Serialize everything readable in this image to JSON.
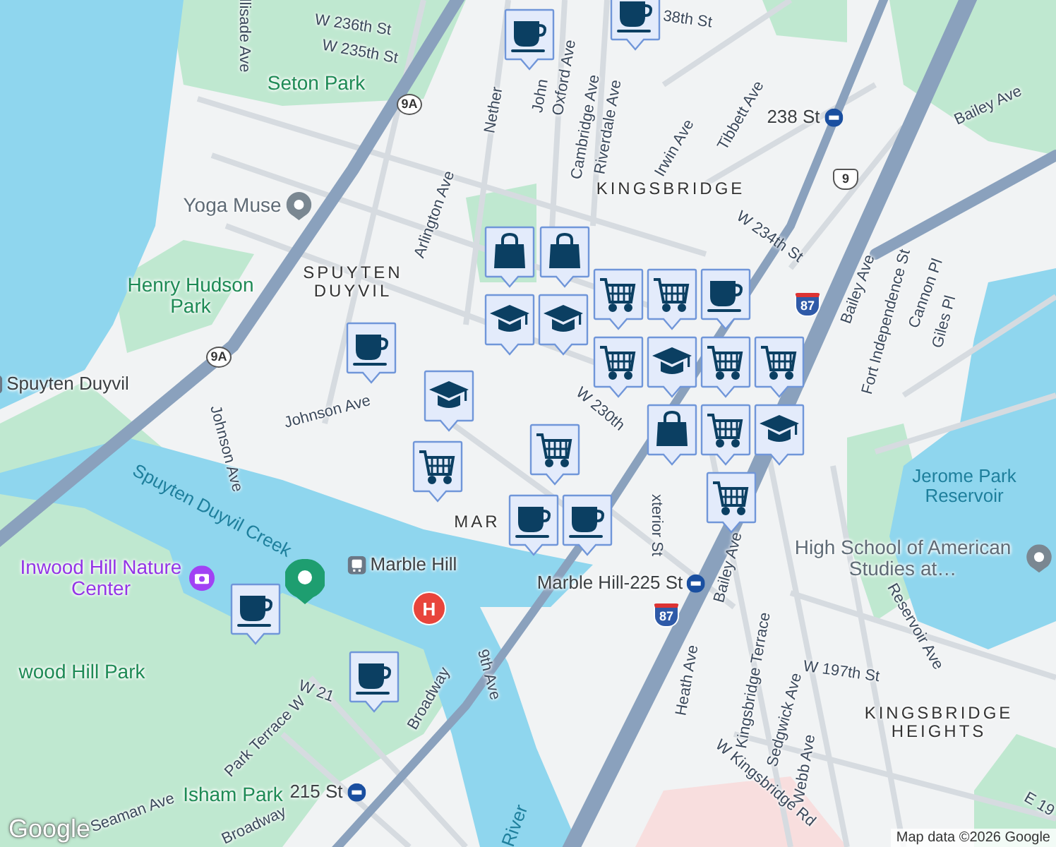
{
  "map": {
    "labels": [
      {
        "text": "W 236th St",
        "kind": "street"
      },
      {
        "text": "W 235th St",
        "kind": "street"
      },
      {
        "text": "llisade Ave",
        "kind": "street"
      },
      {
        "text": "Nether",
        "kind": "street"
      },
      {
        "text": "John",
        "kind": "street"
      },
      {
        "text": "38th St",
        "kind": "street"
      },
      {
        "text": "Oxford Ave",
        "kind": "street"
      },
      {
        "text": "Cambridge Ave",
        "kind": "street"
      },
      {
        "text": "Riverdale Ave",
        "kind": "street"
      },
      {
        "text": "Irwin Ave",
        "kind": "street"
      },
      {
        "text": "Tibbett Ave",
        "kind": "street"
      },
      {
        "text": "Arlington Ave",
        "kind": "street"
      },
      {
        "text": "W 234th St",
        "kind": "street"
      },
      {
        "text": "Bailey Ave",
        "kind": "street"
      },
      {
        "text": "Bailey Ave",
        "kind": "street"
      },
      {
        "text": "Fort Independence St",
        "kind": "street"
      },
      {
        "text": "Cannon Pl",
        "kind": "street"
      },
      {
        "text": "Giles Pl",
        "kind": "street"
      },
      {
        "text": "Johnson Ave",
        "kind": "street"
      },
      {
        "text": "Johnson Ave",
        "kind": "street"
      },
      {
        "text": "W 230th",
        "kind": "street"
      },
      {
        "text": "xterior St",
        "kind": "street"
      },
      {
        "text": "Bailey Ave",
        "kind": "street"
      },
      {
        "text": "Kingsbridge Terrace",
        "kind": "street"
      },
      {
        "text": "Heath Ave",
        "kind": "street"
      },
      {
        "text": "Sedgwick Ave",
        "kind": "street"
      },
      {
        "text": "Webb Ave",
        "kind": "street"
      },
      {
        "text": "W Kingsbridge Rd",
        "kind": "street"
      },
      {
        "text": "W 197th St",
        "kind": "street"
      },
      {
        "text": "Reservoir Ave",
        "kind": "street"
      },
      {
        "text": "E 19",
        "kind": "street"
      },
      {
        "text": "Broadway",
        "kind": "street"
      },
      {
        "text": "Broadway",
        "kind": "street"
      },
      {
        "text": "9th Ave",
        "kind": "street"
      },
      {
        "text": "Park Terrace W",
        "kind": "street"
      },
      {
        "text": "Seaman Ave",
        "kind": "street"
      },
      {
        "text": "W 21",
        "kind": "street"
      },
      {
        "text": "River",
        "kind": "water"
      },
      {
        "text": "Seton Park",
        "kind": "park"
      },
      {
        "text": "Yoga Muse",
        "kind": "poi"
      },
      {
        "text": "SPUYTEN DUYVIL",
        "kind": "area"
      },
      {
        "text": "Henry Hudson Park",
        "kind": "park"
      },
      {
        "text": "Spuyten Duyvil",
        "kind": "rail"
      },
      {
        "text": "KINGSBRIDGE",
        "kind": "area"
      },
      {
        "text": "238 St",
        "kind": "subway"
      },
      {
        "text": "MAR",
        "kind": "area"
      },
      {
        "text": "Spuyten Duyvil Creek",
        "kind": "water"
      },
      {
        "text": "Inwood Hill Nature Center",
        "kind": "museum"
      },
      {
        "text": "Marble Hill",
        "kind": "rail"
      },
      {
        "text": "Marble Hill-225 St",
        "kind": "subway"
      },
      {
        "text": "wood Hill Park",
        "kind": "park"
      },
      {
        "text": "Isham Park",
        "kind": "park"
      },
      {
        "text": "215 St",
        "kind": "subway"
      },
      {
        "text": "Jerome Park Reservoir",
        "kind": "water"
      },
      {
        "text": "High School of American Studies at…",
        "kind": "poi"
      },
      {
        "text": "KINGSBRIDGE HEIGHTS",
        "kind": "area"
      }
    ],
    "shields": [
      {
        "text": "9A",
        "kind": "state"
      },
      {
        "text": "9A",
        "kind": "state"
      },
      {
        "text": "9",
        "kind": "us"
      },
      {
        "text": "87",
        "kind": "interstate"
      },
      {
        "text": "87",
        "kind": "interstate"
      }
    ],
    "markers": [
      {
        "kind": "cup"
      },
      {
        "kind": "cup"
      },
      {
        "kind": "cup"
      },
      {
        "kind": "cap"
      },
      {
        "kind": "cap"
      },
      {
        "kind": "bag"
      },
      {
        "kind": "bag"
      },
      {
        "kind": "cart"
      },
      {
        "kind": "cart"
      },
      {
        "kind": "cup"
      },
      {
        "kind": "cart"
      },
      {
        "kind": "cap"
      },
      {
        "kind": "cart"
      },
      {
        "kind": "bag"
      },
      {
        "kind": "cart"
      },
      {
        "kind": "cart"
      },
      {
        "kind": "cart"
      },
      {
        "kind": "cart"
      },
      {
        "kind": "cup"
      },
      {
        "kind": "cup"
      },
      {
        "kind": "cup"
      },
      {
        "kind": "cup"
      },
      {
        "kind": "cap"
      },
      {
        "kind": "cart"
      },
      {
        "kind": "cap"
      }
    ],
    "hospital": {
      "text": "H"
    },
    "logo": "Google",
    "attribution": "Map data ©2026 Google"
  }
}
